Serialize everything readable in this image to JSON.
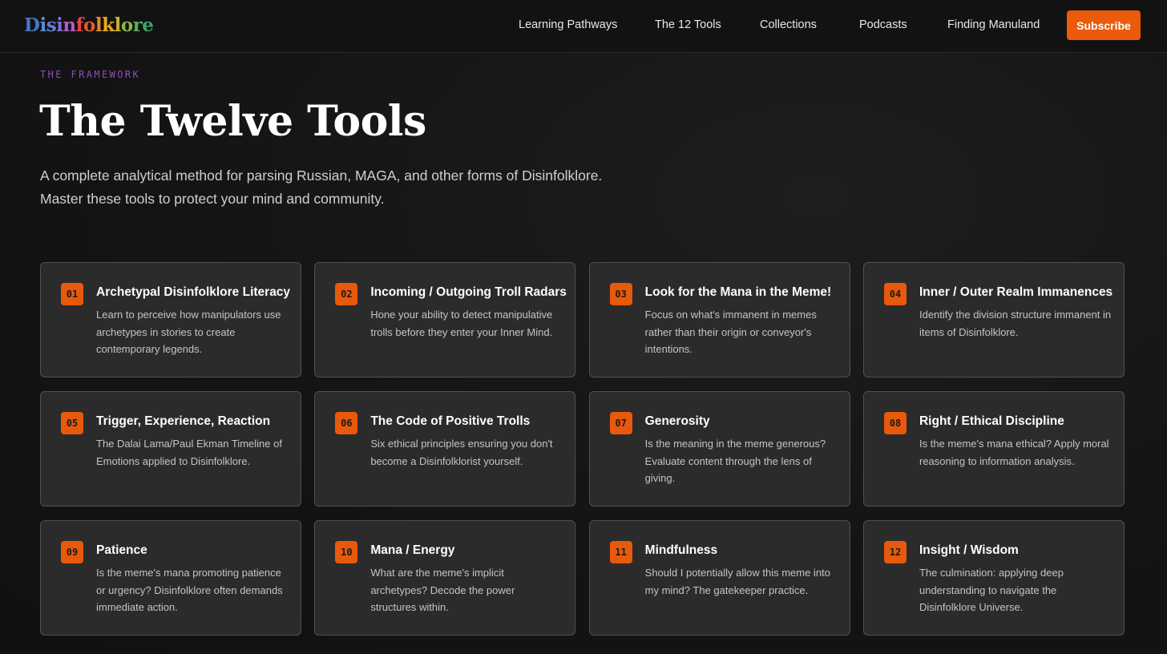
{
  "nav": {
    "logo": {
      "letters": [
        {
          "char": "D",
          "color": "#4a74c9"
        },
        {
          "char": "i",
          "color": "#5c8ad8"
        },
        {
          "char": "s",
          "color": "#5f7fd0"
        },
        {
          "char": "i",
          "color": "#8a6cd0"
        },
        {
          "char": "n",
          "color": "#b15dc6"
        },
        {
          "char": "f",
          "color": "#e0473e"
        },
        {
          "char": "o",
          "color": "#e05a2f"
        },
        {
          "char": "l",
          "color": "#e58a24"
        },
        {
          "char": "k",
          "color": "#e8a81f"
        },
        {
          "char": "l",
          "color": "#c7b52d"
        },
        {
          "char": "o",
          "color": "#8cb34b"
        },
        {
          "char": "r",
          "color": "#5aae55"
        },
        {
          "char": "e",
          "color": "#40a06a"
        }
      ]
    },
    "links": [
      "Learning Pathways",
      "The 12 Tools",
      "Collections",
      "Podcasts",
      "Finding Manuland"
    ],
    "subscribe_label": "Subscribe"
  },
  "hero": {
    "eyebrow": "THE FRAMEWORK",
    "title": "The Twelve Tools",
    "subtitle_line1": "A complete analytical method for parsing Russian, MAGA, and other forms of Disinfolklore.",
    "subtitle_line2": "Master these tools to protect your mind and community."
  },
  "tools": [
    {
      "number": "01",
      "title": "Archetypal Disinfolklore Literacy",
      "description": "Learn to perceive how manipulators use archetypes in stories to create contemporary legends."
    },
    {
      "number": "02",
      "title": "Incoming / Outgoing Troll Radars",
      "description": "Hone your ability to detect manipulative trolls before they enter your Inner Mind."
    },
    {
      "number": "03",
      "title": "Look for the Mana in the Meme!",
      "description": "Focus on what's immanent in memes rather than their origin or conveyor's intentions."
    },
    {
      "number": "04",
      "title": "Inner / Outer Realm Immanences",
      "description": "Identify the division structure immanent in items of Disinfolklore."
    },
    {
      "number": "05",
      "title": "Trigger, Experience, Reaction",
      "description": "The Dalai Lama/Paul Ekman Timeline of Emotions applied to Disinfolklore."
    },
    {
      "number": "06",
      "title": "The Code of Positive Trolls",
      "description": "Six ethical principles ensuring you don't become a Disinfolklorist yourself."
    },
    {
      "number": "07",
      "title": "Generosity",
      "description": "Is the meaning in the meme generous? Evaluate content through the lens of giving."
    },
    {
      "number": "08",
      "title": "Right / Ethical Discipline",
      "description": "Is the meme's mana ethical? Apply moral reasoning to information analysis."
    },
    {
      "number": "09",
      "title": "Patience",
      "description": "Is the meme's mana promoting patience or urgency? Disinfolklore often demands immediate action."
    },
    {
      "number": "10",
      "title": "Mana / Energy",
      "description": "What are the meme's implicit archetypes? Decode the power structures within."
    },
    {
      "number": "11",
      "title": "Mindfulness",
      "description": "Should I potentially allow this meme into my mind? The gatekeeper practice."
    },
    {
      "number": "12",
      "title": "Insight / Wisdom",
      "description": "The culmination: applying deep understanding to navigate the Disinfolklore Universe."
    }
  ]
}
